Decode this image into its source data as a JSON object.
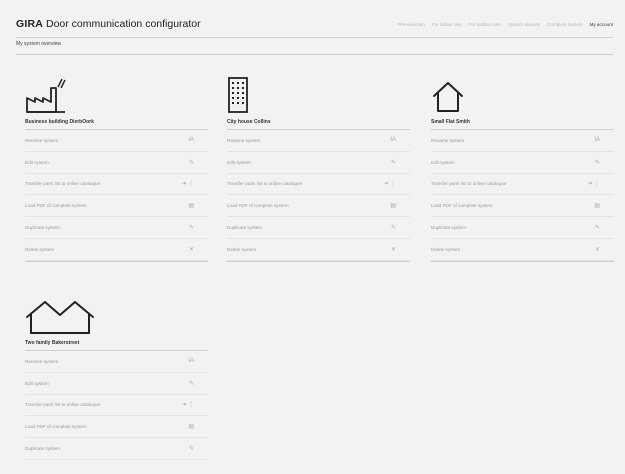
{
  "header": {
    "brand": "GIRA",
    "app_title": "Door communication configurator",
    "nav": [
      "Pre-selection",
      "For indoor use",
      "For outdoor use",
      "System devices",
      "Complete system",
      "My account"
    ]
  },
  "page": {
    "title": "My system overview"
  },
  "actions": {
    "rename": "Rename system",
    "edit": "Edit system",
    "transfer": "Transfer parts list to online catalogue",
    "pdf": "Load PDF of complete system",
    "duplicate": "Duplicate system",
    "delete": "Delete system"
  },
  "icons": {
    "rename": "text-cursor-icon",
    "edit": "pencil-icon",
    "transfer": "export-icon",
    "pdf": "pdf-document-icon",
    "duplicate": "duplicate-pencil-icon",
    "delete": "close-icon"
  },
  "systems": [
    {
      "name": "Business building DierbOork",
      "icon": "factory-icon"
    },
    {
      "name": "City house Collins",
      "icon": "apartment-building-icon"
    },
    {
      "name": "Small Flat Smith",
      "icon": "house-icon"
    },
    {
      "name": "Two family Bakerstreet",
      "icon": "two-family-house-icon"
    }
  ]
}
